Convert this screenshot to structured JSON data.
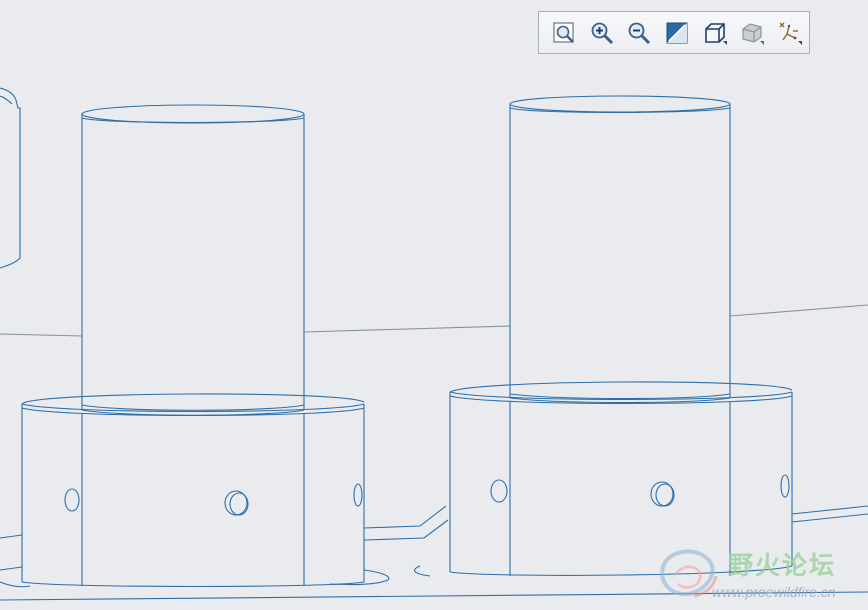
{
  "viewport": {
    "background_color": "#e9ebef",
    "edge_color": "#2f6fa8",
    "floor_line_color": "#8a8f97"
  },
  "toolbar": {
    "buttons": [
      {
        "id": "refit",
        "icon": "refit-icon"
      },
      {
        "id": "zoom-in",
        "icon": "zoom-in-icon"
      },
      {
        "id": "zoom-out",
        "icon": "zoom-out-icon"
      },
      {
        "id": "repaint",
        "icon": "repaint-icon"
      },
      {
        "id": "display-style",
        "icon": "display-style-cube-icon"
      },
      {
        "id": "saved-views",
        "icon": "saved-views-icon"
      },
      {
        "id": "datum-display",
        "icon": "datum-display-icon"
      }
    ]
  },
  "watermark": {
    "title": "野火论坛",
    "url": "www.proewildfire.cn"
  }
}
